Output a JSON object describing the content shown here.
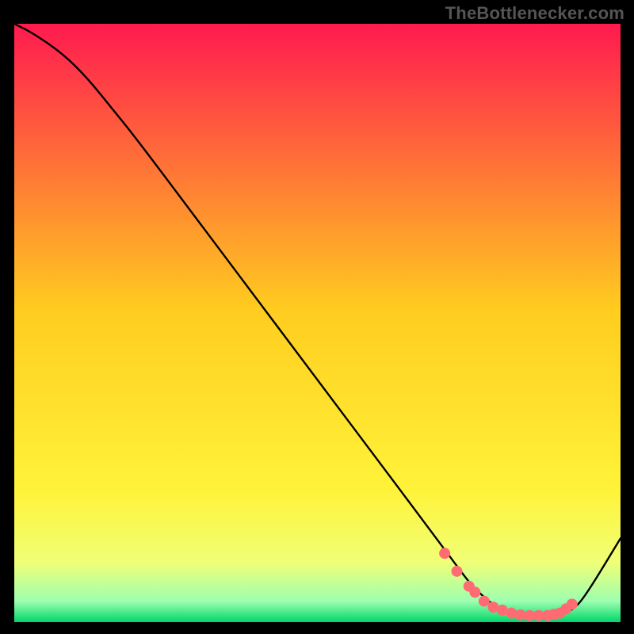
{
  "watermark": "TheBottlenecker.com",
  "chart_data": {
    "type": "line",
    "title": "",
    "xlabel": "",
    "ylabel": "",
    "xlim": [
      0,
      100
    ],
    "ylim": [
      0,
      100
    ],
    "grid": false,
    "background_gradient": [
      {
        "stop": 0.0,
        "color": "#ff1a4f"
      },
      {
        "stop": 0.48,
        "color": "#ffcd1f"
      },
      {
        "stop": 0.78,
        "color": "#fff33a"
      },
      {
        "stop": 0.9,
        "color": "#f0ff76"
      },
      {
        "stop": 0.965,
        "color": "#9dffb0"
      },
      {
        "stop": 1.0,
        "color": "#00d66a"
      }
    ],
    "series": [
      {
        "name": "curve",
        "color": "#000000",
        "x": [
          0,
          3,
          8,
          12,
          16,
          20,
          30,
          40,
          50,
          60,
          70,
          74,
          76,
          80,
          84,
          88,
          90,
          92,
          94,
          100
        ],
        "y": [
          100,
          98.5,
          95,
          91,
          86,
          81,
          67.5,
          54,
          40.5,
          27,
          13.5,
          8,
          5.5,
          2,
          1,
          1,
          1.2,
          2,
          4,
          14
        ]
      },
      {
        "name": "highlight-dots",
        "type": "scatter",
        "color": "#ff6b72",
        "radius": 7,
        "x": [
          71,
          73,
          75,
          76,
          77.5,
          79,
          80.5,
          82,
          83.5,
          85,
          86.5,
          88,
          89,
          90,
          91,
          92
        ],
        "y": [
          11.5,
          8.5,
          6,
          5,
          3.5,
          2.5,
          2,
          1.5,
          1.2,
          1.1,
          1.1,
          1.1,
          1.3,
          1.5,
          2.2,
          3
        ]
      }
    ]
  }
}
